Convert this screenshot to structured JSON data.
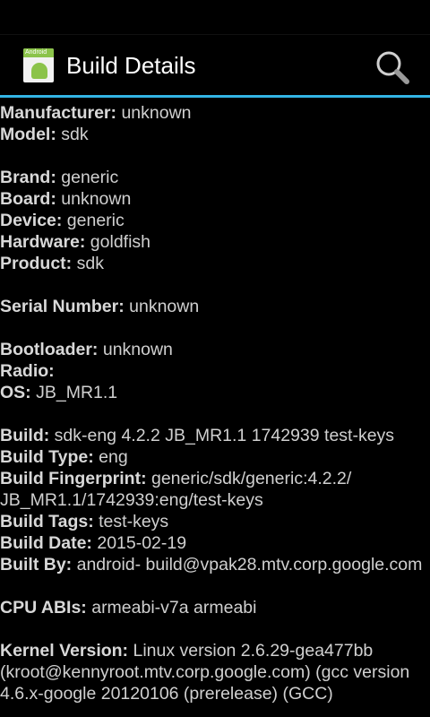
{
  "actionbar": {
    "title": "Build Details",
    "app_icon_text": "Android",
    "search_icon": "search-icon"
  },
  "colors": {
    "accent": "#33b5e5",
    "background": "#000000",
    "text": "#d0d0d0"
  },
  "groups": [
    [
      {
        "label": "Manufacturer:",
        "value": "unknown"
      },
      {
        "label": "Model:",
        "value": "sdk"
      }
    ],
    [
      {
        "label": "Brand:",
        "value": "generic"
      },
      {
        "label": "Board:",
        "value": "unknown"
      },
      {
        "label": "Device:",
        "value": "generic"
      },
      {
        "label": "Hardware:",
        "value": "goldfish"
      },
      {
        "label": "Product:",
        "value": "sdk"
      }
    ],
    [
      {
        "label": "Serial Number:",
        "value": "unknown"
      }
    ],
    [
      {
        "label": "Bootloader:",
        "value": "unknown"
      },
      {
        "label": "Radio:",
        "value": ""
      },
      {
        "label": "OS:",
        "value": "JB_MR1.1"
      }
    ],
    [
      {
        "label": "Build:",
        "value": "sdk-eng 4.2.2 JB_MR1.1 1742939 test-keys"
      },
      {
        "label": "Build Type:",
        "value": "eng"
      },
      {
        "label": "Build Fingerprint:",
        "value": "generic/sdk/generic:4.2.2/ JB_MR1.1/1742939:eng/test-keys"
      },
      {
        "label": "Build Tags:",
        "value": "test-keys"
      },
      {
        "label": "Build Date:",
        "value": "2015-02-19"
      },
      {
        "label": "Built By:",
        "value": "android- build@vpak28.mtv.corp.google.com"
      }
    ],
    [
      {
        "label": "CPU ABIs:",
        "value": "armeabi-v7a armeabi"
      }
    ],
    [
      {
        "label": "Kernel Version:",
        "value": "Linux version 2.6.29-gea477bb (kroot@kennyroot.mtv.corp.google.com) (gcc version 4.6.x-google 20120106 (prerelease) (GCC)"
      }
    ]
  ]
}
